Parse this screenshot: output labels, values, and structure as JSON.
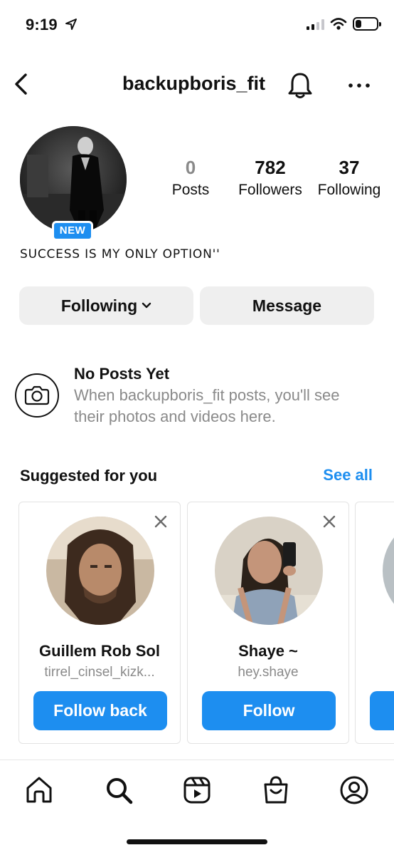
{
  "status_bar": {
    "time": "9:19",
    "battery_level": 0.3
  },
  "header": {
    "username": "backupboris_fit"
  },
  "profile": {
    "badge": "NEW",
    "stats": [
      {
        "value": "0",
        "label": "Posts",
        "dim": true
      },
      {
        "value": "782",
        "label": "Followers",
        "dim": false
      },
      {
        "value": "37",
        "label": "Following",
        "dim": false
      }
    ],
    "bio": "SUCCESS IS MY ONLY OPTION''"
  },
  "actions": {
    "following_label": "Following",
    "message_label": "Message"
  },
  "no_posts": {
    "title": "No Posts Yet",
    "text": "When backupboris_fit posts, you'll see their photos and videos here."
  },
  "suggested": {
    "title": "Suggested for you",
    "see_all": "See all",
    "cards": [
      {
        "name": "Guillem Rob Sol",
        "handle": "tirrel_cinsel_kizk...",
        "button": "Follow back"
      },
      {
        "name": "Shaye ~",
        "handle": "hey.shaye",
        "button": "Follow"
      }
    ]
  },
  "tabbar": {
    "items": [
      "home-icon",
      "search-icon",
      "reels-icon",
      "shop-icon",
      "profile-icon"
    ]
  },
  "colors": {
    "accent": "#1d8ef0",
    "muted": "#8a8a8a",
    "button_grey": "#efefef"
  }
}
